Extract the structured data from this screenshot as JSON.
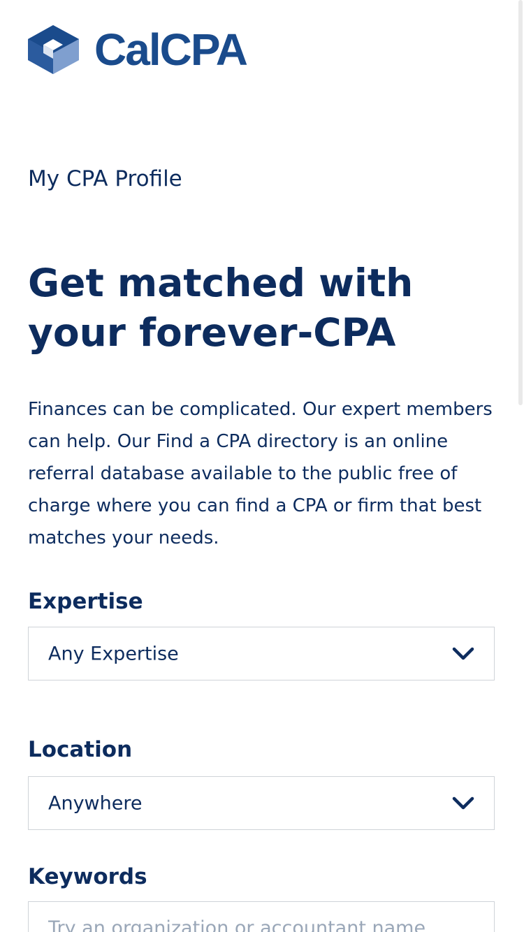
{
  "brand": {
    "name": "CalCPA",
    "colors": {
      "primary": "#0d2c5e",
      "logo": "#1a4b8c",
      "border": "#cfd3d8",
      "placeholder": "#9aa7b8"
    }
  },
  "header": {
    "subtitle": "My CPA Profile"
  },
  "hero": {
    "headline": "Get matched with your forever-CPA",
    "intro": "Finances can be complicated. Our expert members can help. Our Find a CPA directory is an online referral database available to the public free of charge where you can find a CPA or firm that best matches your needs."
  },
  "form": {
    "expertise": {
      "label": "Expertise",
      "value": "Any Expertise",
      "icon": "chevron-down-icon"
    },
    "location": {
      "label": "Location",
      "value": "Anywhere",
      "icon": "chevron-down-icon"
    },
    "keywords": {
      "label": "Keywords",
      "placeholder": "Try an organization or accountant name",
      "value": ""
    }
  }
}
